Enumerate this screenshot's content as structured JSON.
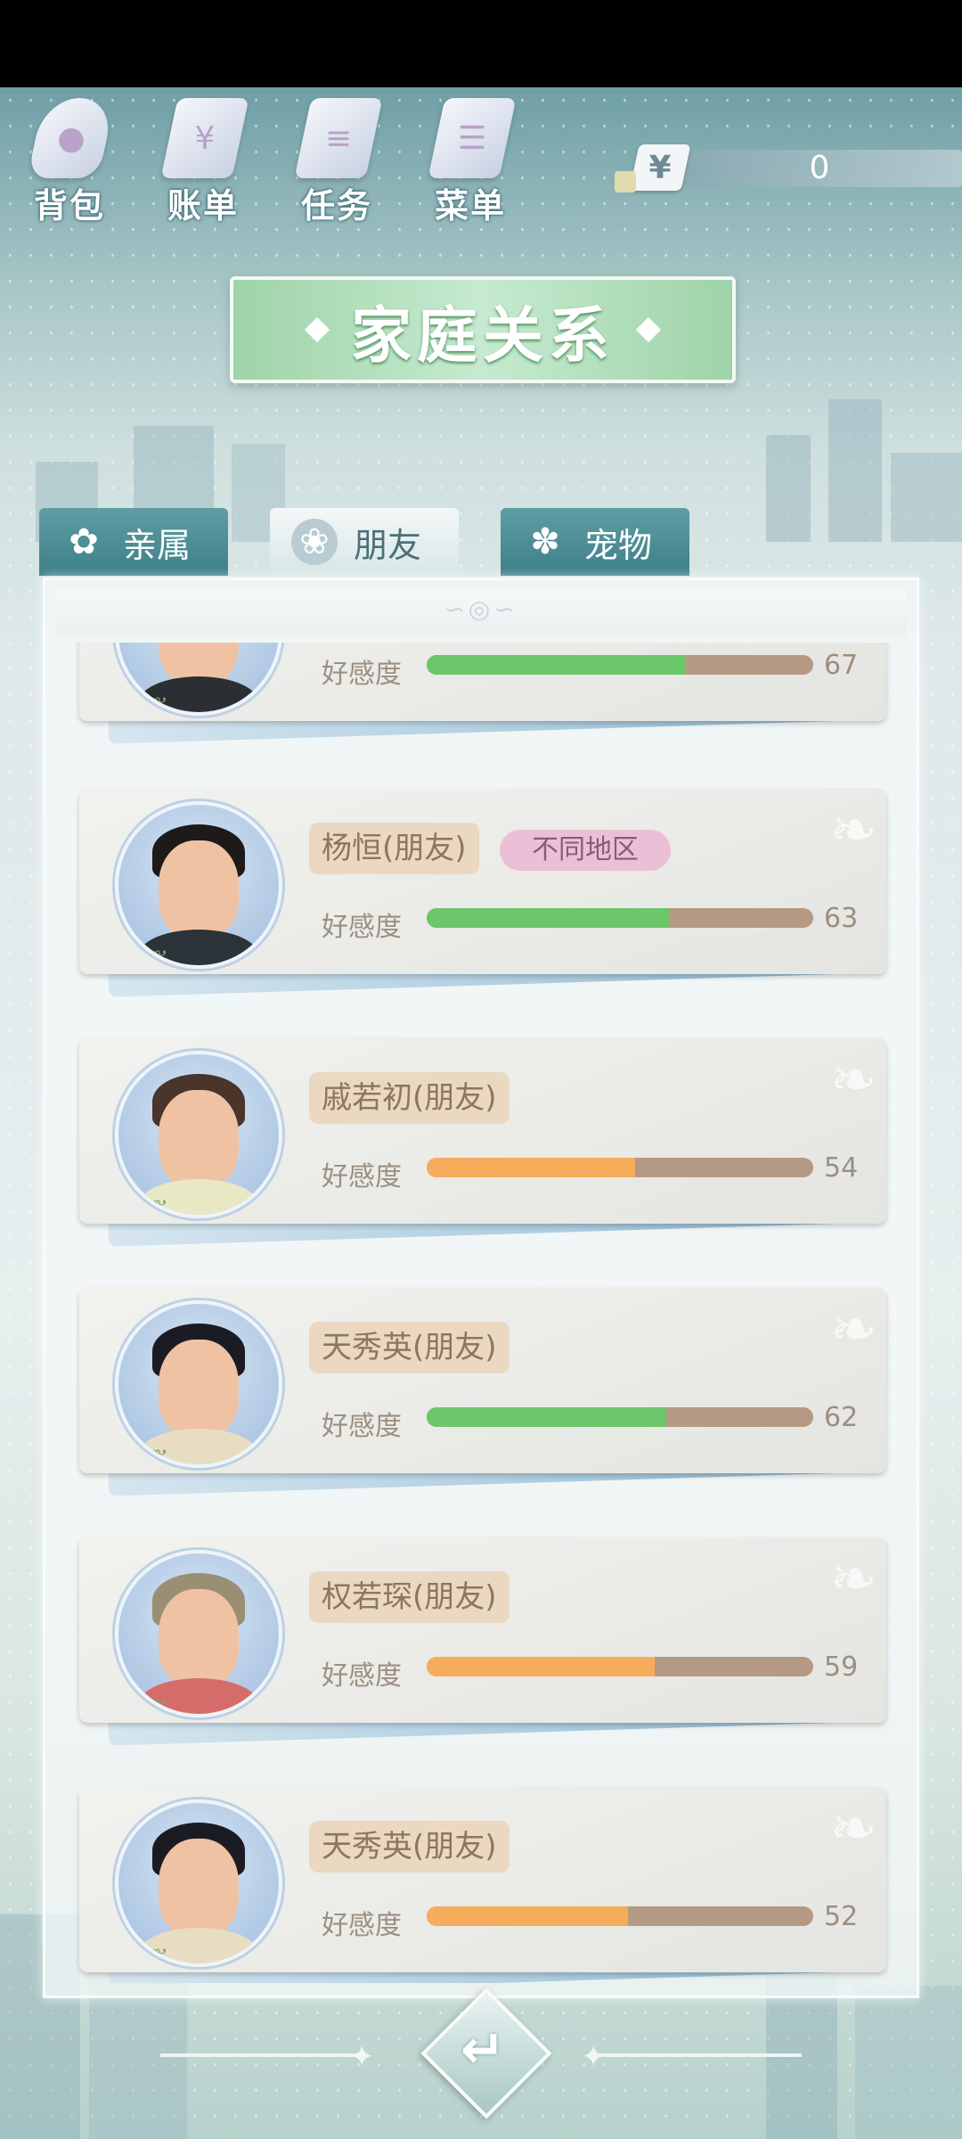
{
  "hud": {
    "bag_label": "背包",
    "bill_label": "账单",
    "task_label": "任务",
    "menu_label": "菜单",
    "currency_symbol": "¥",
    "money": "0"
  },
  "title": "家庭关系",
  "tabs": [
    {
      "label": "亲属",
      "icon": "sakura-icon",
      "active": false
    },
    {
      "label": "朋友",
      "icon": "flower-icon",
      "active": true
    },
    {
      "label": "宠物",
      "icon": "gear-flower-icon",
      "active": false
    }
  ],
  "affinity_label": "好感度",
  "friends": [
    {
      "name": "",
      "region": "",
      "affinity": 67,
      "bar_color": "#6cc66a",
      "hair_color": "#3a2c28",
      "shirt_color": "#2b2f33"
    },
    {
      "name": "杨恒(朋友)",
      "region": "不同地区",
      "affinity": 63,
      "bar_color": "#6cc66a",
      "hair_color": "#1e1a1a",
      "shirt_color": "#2b3238"
    },
    {
      "name": "戚若初(朋友)",
      "region": "",
      "affinity": 54,
      "bar_color": "#f5ad5c",
      "hair_color": "#4a342b",
      "shirt_color": "#e9e8c5"
    },
    {
      "name": "天秀英(朋友)",
      "region": "",
      "affinity": 62,
      "bar_color": "#6cc66a",
      "hair_color": "#1b1b24",
      "shirt_color": "#e8ddc2"
    },
    {
      "name": "权若琛(朋友)",
      "region": "",
      "affinity": 59,
      "bar_color": "#f5ad5c",
      "hair_color": "#9a8e74",
      "shirt_color": "#d66c6a"
    },
    {
      "name": "天秀英(朋友)",
      "region": "",
      "affinity": 52,
      "bar_color": "#f5ad5c",
      "hair_color": "#1b1b24",
      "shirt_color": "#e8ddc2"
    }
  ],
  "back_button": {
    "icon": "return-arrow-icon"
  }
}
